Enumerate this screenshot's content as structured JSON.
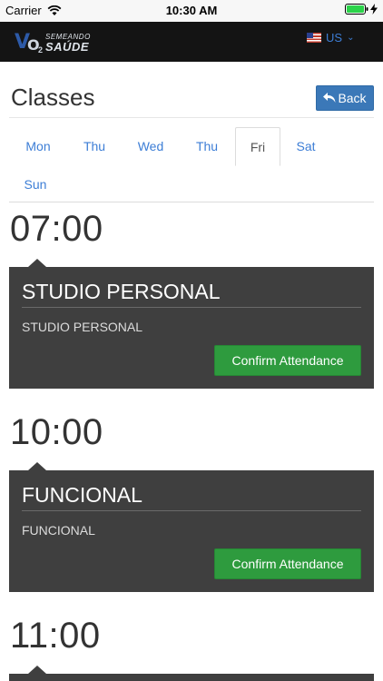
{
  "status_bar": {
    "carrier": "Carrier",
    "time": "10:30 AM"
  },
  "header": {
    "logo_line1": "SEMEANDO",
    "logo_line2": "SAÚDE",
    "logo_mark_v": "V",
    "logo_mark_o": "O",
    "logo_mark_2": "2",
    "language": "US"
  },
  "page": {
    "title": "Classes",
    "back_label": "Back"
  },
  "tabs": [
    "Mon",
    "Thu",
    "Wed",
    "Thu",
    "Fri",
    "Sat",
    "Sun"
  ],
  "active_tab": "Fri",
  "sessions": [
    {
      "time": "07:00",
      "title": "STUDIO PERSONAL",
      "subtitle": "STUDIO PERSONAL",
      "button": "Confirm Attendance"
    },
    {
      "time": "10:00",
      "title": "FUNCIONAL",
      "subtitle": "FUNCIONAL",
      "button": "Confirm Attendance"
    },
    {
      "time": "11:00"
    }
  ],
  "colors": {
    "accent": "#3b78b8",
    "confirm": "#2e9b3e",
    "card": "#3f3f3f",
    "header": "#141414"
  }
}
